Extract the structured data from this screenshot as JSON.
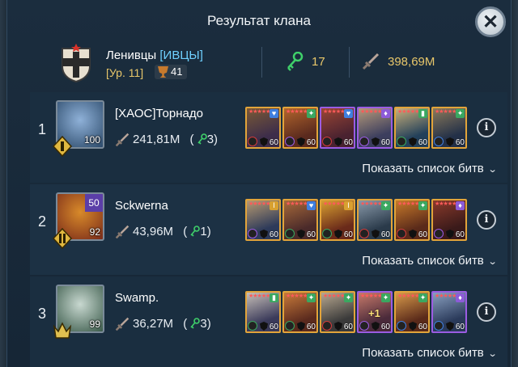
{
  "title": "Результат клана",
  "clan": {
    "name": "Ленивцы",
    "tag": "[ИВЦЫ]",
    "level": "[Ур. 11]",
    "trophies": "41",
    "keys": "17",
    "damage": "398,69М"
  },
  "battles_label": "Показать список битв",
  "members": [
    {
      "rank": "1",
      "name": "[ХАОС]Торнадо",
      "level": "100",
      "rank_badge": "",
      "damage": "241,81М",
      "keys": "( 3)",
      "avatar_colors": [
        "#2c4a6a",
        "#8fb1d8"
      ],
      "champs": [
        {
          "rarity": "legendary",
          "c1": "#3d2d4a",
          "c2": "#7a5a35",
          "lvl": "60",
          "badge": "♥",
          "badge_color": "#3f7fe0",
          "aff": "#d23b3b"
        },
        {
          "rarity": "legendary",
          "c1": "#5a2a1e",
          "c2": "#b2652c",
          "lvl": "60",
          "badge": "✦",
          "badge_color": "#3aa860",
          "aff": "#9b5ce3"
        },
        {
          "rarity": "epic",
          "c1": "#4a2230",
          "c2": "#9a4634",
          "lvl": "60",
          "badge": "♥",
          "badge_color": "#3f7fe0",
          "aff": "#d23b3b"
        },
        {
          "rarity": "epic",
          "c1": "#3c3e5e",
          "c2": "#b59a7a",
          "lvl": "60",
          "badge": "♦",
          "badge_color": "#8d5bd8",
          "aff": "#9b5ce3"
        },
        {
          "rarity": "legendary",
          "c1": "#23405a",
          "c2": "#c8b07a",
          "lvl": "60",
          "badge": "▮",
          "badge_color": "#3aa860",
          "aff": "#3aa860"
        },
        {
          "rarity": "legendary",
          "c1": "#233048",
          "c2": "#8b7a5a",
          "lvl": "60",
          "badge": "✦",
          "badge_color": "#3aa860",
          "aff": "#3f7fe0"
        }
      ]
    },
    {
      "rank": "2",
      "name": "Sckwerna",
      "level": "92",
      "rank_badge": "50",
      "damage": "43,96М",
      "keys": "( 1)",
      "avatar_colors": [
        "#7a2b1a",
        "#d88a2a"
      ],
      "champs": [
        {
          "rarity": "legendary",
          "c1": "#2d3a5a",
          "c2": "#b89a70",
          "lvl": "60",
          "badge": "I",
          "badge_color": "#d8a030",
          "aff": "#9b5ce3"
        },
        {
          "rarity": "legendary",
          "c1": "#4a2a2a",
          "c2": "#a86a3a",
          "lvl": "60",
          "badge": "♥",
          "badge_color": "#3f7fe0",
          "aff": "#3aa860"
        },
        {
          "rarity": "legendary",
          "c1": "#6a2a1a",
          "c2": "#d8a030",
          "lvl": "60",
          "badge": "I",
          "badge_color": "#d8a030",
          "aff": "#3aa860"
        },
        {
          "rarity": "legendary",
          "c1": "#2a3a4a",
          "c2": "#8a9aaa",
          "lvl": "60",
          "badge": "✦",
          "badge_color": "#3aa860",
          "aff": "#d23b3b"
        },
        {
          "rarity": "legendary",
          "c1": "#5a2a1a",
          "c2": "#c87a2a",
          "lvl": "60",
          "badge": "✦",
          "badge_color": "#3aa860",
          "aff": "#d23b3b"
        },
        {
          "rarity": "legendary",
          "c1": "#3a1a1a",
          "c2": "#8a3a2a",
          "lvl": "60",
          "badge": "♦",
          "badge_color": "#8d5bd8",
          "aff": "#9b5ce3"
        }
      ]
    },
    {
      "rank": "3",
      "name": "Swamp.",
      "level": "99",
      "rank_badge": "",
      "damage": "36,27М",
      "keys": "( 3)",
      "avatar_colors": [
        "#3a5a4a",
        "#c8d8d0"
      ],
      "champs": [
        {
          "rarity": "legendary",
          "c1": "#3a3a5a",
          "c2": "#c8c0b8",
          "lvl": "60",
          "badge": "▮",
          "badge_color": "#3aa860",
          "aff": "#3aa860"
        },
        {
          "rarity": "legendary",
          "c1": "#5a2a1e",
          "c2": "#c87a3a",
          "lvl": "60",
          "badge": "✦",
          "badge_color": "#3aa860",
          "aff": "#3aa860"
        },
        {
          "rarity": "legendary",
          "c1": "#3a3a3a",
          "c2": "#b8a890",
          "lvl": "60",
          "badge": "✦",
          "badge_color": "#3aa860",
          "aff": "#d23b3b"
        },
        {
          "rarity": "epic",
          "c1": "#4a2a3a",
          "c2": "#c87a6a",
          "lvl": "60",
          "badge": "✦",
          "badge_color": "#3aa860",
          "aff": "#9b5ce3",
          "boost": "+1"
        },
        {
          "rarity": "legendary",
          "c1": "#5a2a1a",
          "c2": "#d89a4a",
          "lvl": "60",
          "badge": "✦",
          "badge_color": "#3aa860",
          "aff": "#3f7fe0"
        },
        {
          "rarity": "epic",
          "c1": "#2a3a5a",
          "c2": "#8aa0c0",
          "lvl": "60",
          "badge": "♦",
          "badge_color": "#8d5bd8",
          "aff": "#3f7fe0"
        }
      ]
    }
  ]
}
